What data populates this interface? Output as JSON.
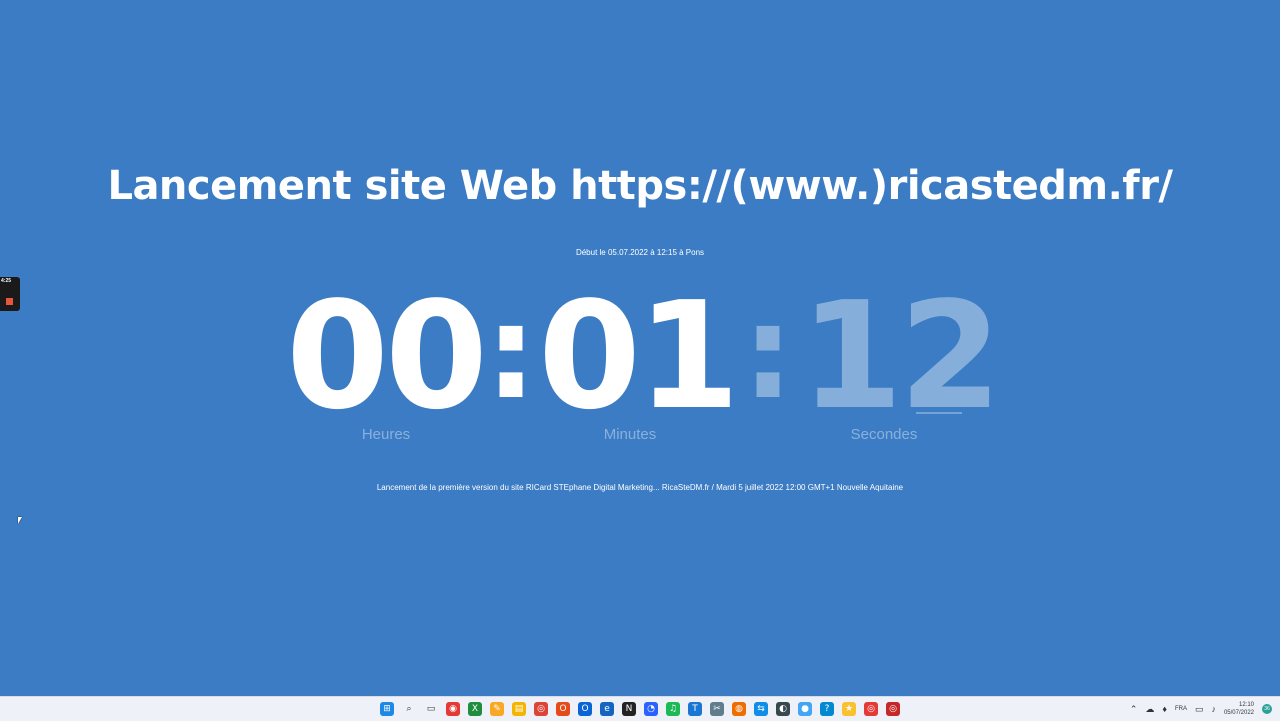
{
  "page": {
    "title": "Lancement site Web https://(www.)ricastedm.fr/",
    "start_info": "Début le 05.07.2022 à 12:15 à Pons",
    "footer": "Lancement de la première version du site RICard STEphane Digital Marketing... RicaSteDM.fr / Mardi 5 juillet 2022 12:00 GMT+1 Nouvelle Aquitaine"
  },
  "countdown": {
    "hours": "00",
    "minutes": "01",
    "seconds": "12",
    "separator": ":",
    "labels": {
      "hours": "Heures",
      "minutes": "Minutes",
      "seconds": "Secondes"
    }
  },
  "recorder": {
    "elapsed": "4:25"
  },
  "taskbar": {
    "apps": [
      {
        "name": "start-icon",
        "glyph": "⊞",
        "color": "#1e88e5"
      },
      {
        "name": "search-icon",
        "glyph": "⌕",
        "color": "#333333"
      },
      {
        "name": "task-view-icon",
        "glyph": "▭",
        "color": "#333333"
      },
      {
        "name": "red-app-icon",
        "glyph": "◉",
        "color": "#e53935"
      },
      {
        "name": "excel-icon",
        "glyph": "X",
        "color": "#1e8e3e"
      },
      {
        "name": "notes-app-icon",
        "glyph": "✎",
        "color": "#f9a825"
      },
      {
        "name": "file-explorer-icon",
        "glyph": "▤",
        "color": "#f4b400"
      },
      {
        "name": "chrome-icon",
        "glyph": "◎",
        "color": "#db4437"
      },
      {
        "name": "office-icon",
        "glyph": "O",
        "color": "#e64a19"
      },
      {
        "name": "outlook-icon",
        "glyph": "O",
        "color": "#0a64d6"
      },
      {
        "name": "edge-icon",
        "glyph": "e",
        "color": "#1565c0"
      },
      {
        "name": "notion-icon",
        "glyph": "N",
        "color": "#222222"
      },
      {
        "name": "chat-app-icon",
        "glyph": "◔",
        "color": "#2962ff"
      },
      {
        "name": "spotify-icon",
        "glyph": "♫",
        "color": "#1db954"
      },
      {
        "name": "teams-icon",
        "glyph": "T",
        "color": "#1976d2"
      },
      {
        "name": "snipping-icon",
        "glyph": "✂",
        "color": "#607d8b"
      },
      {
        "name": "firefox-icon",
        "glyph": "◍",
        "color": "#ef6c00"
      },
      {
        "name": "teamviewer-icon",
        "glyph": "⇆",
        "color": "#0e8ee9"
      },
      {
        "name": "app-dark-icon",
        "glyph": "◐",
        "color": "#37474f"
      },
      {
        "name": "app-blue-icon",
        "glyph": "●",
        "color": "#42a5f5"
      },
      {
        "name": "help-icon",
        "glyph": "?",
        "color": "#0288d1"
      },
      {
        "name": "app-yellow-icon",
        "glyph": "★",
        "color": "#fbc02d"
      },
      {
        "name": "chrome-profile-icon",
        "glyph": "◎",
        "color": "#e53935"
      },
      {
        "name": "chrome-profile-2-icon",
        "glyph": "◎",
        "color": "#c62828"
      }
    ],
    "tray": {
      "language": "FRA",
      "time": "12:10",
      "date": "05/07/2022",
      "notifications": "36"
    }
  }
}
